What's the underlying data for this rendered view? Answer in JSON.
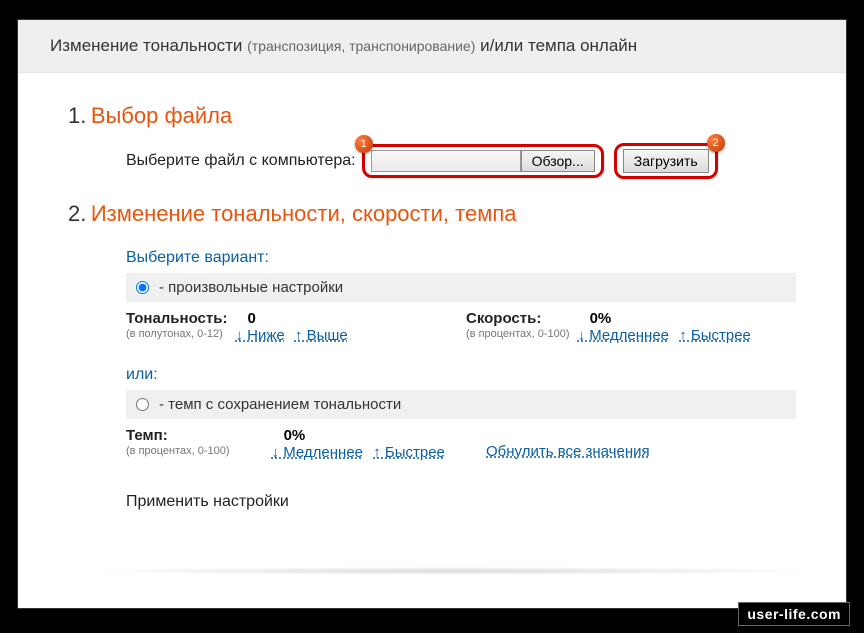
{
  "header": {
    "title_prefix": "Изменение тональности ",
    "title_paren": "(транспозиция, транспонирование)",
    "title_suffix": " и/или темпа онлайн"
  },
  "step1": {
    "num": "1.",
    "title": "Выбор файла",
    "prompt": "Выберите файл с компьютера:",
    "browse": "Обзор...",
    "upload": "Загрузить",
    "badge1": "1",
    "badge2": "2"
  },
  "step2": {
    "num": "2.",
    "title": "Изменение тональности, скорости, темпа",
    "variant_label": "Выберите вариант:",
    "option_custom": " - произвольные настройки",
    "pitch": {
      "name": "Тональность:",
      "value": "0",
      "hint": "(в полутонах, 0-12)",
      "lower": "↓ Ниже",
      "higher": "↑ Выше"
    },
    "speed": {
      "name": "Скорость:",
      "value": "0%",
      "hint": "(в процентах, 0-100)",
      "slower": "↓ Медленнее",
      "faster": "↑ Быстрее"
    },
    "or_label": "или:",
    "option_tempo": " - темп с сохранением тональности",
    "tempo": {
      "name": "Темп:",
      "value": "0%",
      "hint": "(в процентах, 0-100)",
      "slower": "↓ Медленнее",
      "faster": "↑ Быстрее"
    },
    "reset": "Обнулить все значения"
  },
  "apply": "Применить настройки",
  "footer": "user-life.com"
}
